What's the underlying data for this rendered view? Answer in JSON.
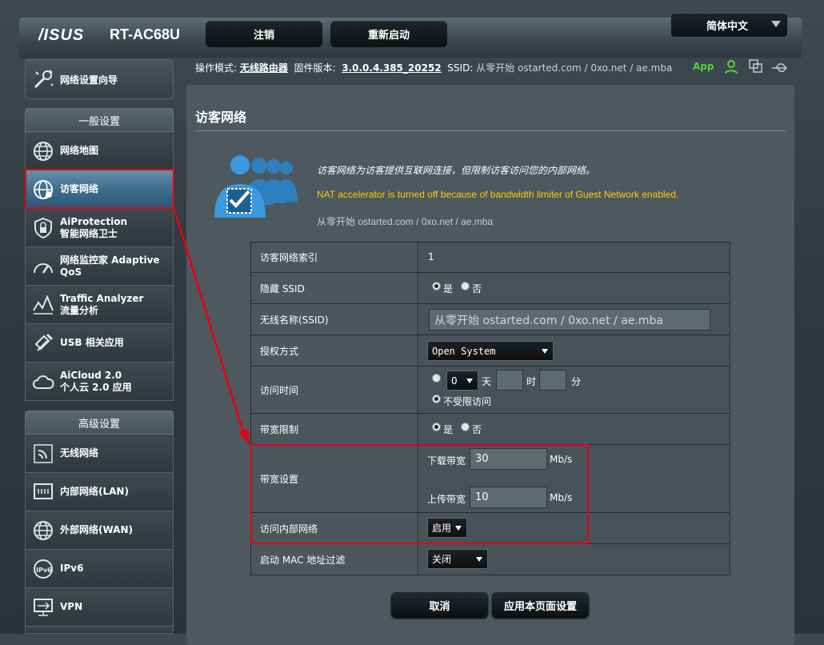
{
  "header": {
    "logo": "/ISUS",
    "model": "RT-AC68U",
    "logout_label": "注销",
    "reboot_label": "重新启动",
    "language": "简体中文"
  },
  "status": {
    "mode_label": "操作模式:",
    "mode_value": "无线路由器",
    "firmware_label": "固件版本:",
    "firmware_value": "3.0.0.4.385_20252",
    "ssid_label": "SSID:",
    "ssid_value": "从零开始 ostarted.com / 0xo.net / ae.mba",
    "app_label": "App"
  },
  "sidebar": {
    "wizard": "网络设置向导",
    "general_header": "一般设置",
    "general_items": [
      {
        "l1": "网络地图",
        "l2": ""
      },
      {
        "l1": "访客网络",
        "l2": ""
      },
      {
        "l1": "AiProtection",
        "l2": "智能网络卫士"
      },
      {
        "l1": "网络监控家 Adaptive",
        "l2": "QoS"
      },
      {
        "l1": "Traffic Analyzer",
        "l2": "流量分析"
      },
      {
        "l1": "USB 相关应用",
        "l2": ""
      },
      {
        "l1": "AiCloud 2.0",
        "l2": "个人云 2.0 应用"
      }
    ],
    "advanced_header": "高级设置",
    "advanced_items": [
      "无线网络",
      "内部网络(LAN)",
      "外部网络(WAN)",
      "IPv6",
      "VPN"
    ]
  },
  "main": {
    "title": "访客网络",
    "description": "访客网络为访客提供互联网连接，但限制访客访问您的内部网络。",
    "warning": "NAT accelerator is turned off because of bandwidth limiter of Guest Network enabled.",
    "watermark": "从零开始 ostarted.com / 0xo.net / ae.mba"
  },
  "form": {
    "index_label": "访客网络索引",
    "index_value": "1",
    "hide_ssid_label": "隐藏 SSID",
    "yes": "是",
    "no": "否",
    "ssid_label": "无线名称(SSID)",
    "ssid_value": "从零开始 ostarted.com / 0xo.net / ae.mba",
    "auth_label": "授权方式",
    "auth_value": "Open System",
    "access_time_label": "访问时间",
    "days_value": "0",
    "day_unit": "天",
    "hour_unit": "时",
    "minute_unit": "分",
    "unlimited": "不受限访问",
    "bw_limit_label": "带宽限制",
    "bw_setting_label": "带宽设置",
    "download_label": "下载带宽",
    "download_value": "30",
    "upload_label": "上传带宽",
    "upload_value": "10",
    "unit": "Mb/s",
    "intranet_label": "访问内部网络",
    "intranet_value": "启用",
    "mac_filter_label": "启动 MAC 地址过滤",
    "mac_filter_value": "关闭"
  },
  "buttons": {
    "cancel": "取消",
    "apply": "应用本页面设置"
  },
  "colors": {
    "highlight": "#e60012",
    "warning": "#ffcc00",
    "app": "#53d23a",
    "active_item": "#3e6d8e"
  }
}
